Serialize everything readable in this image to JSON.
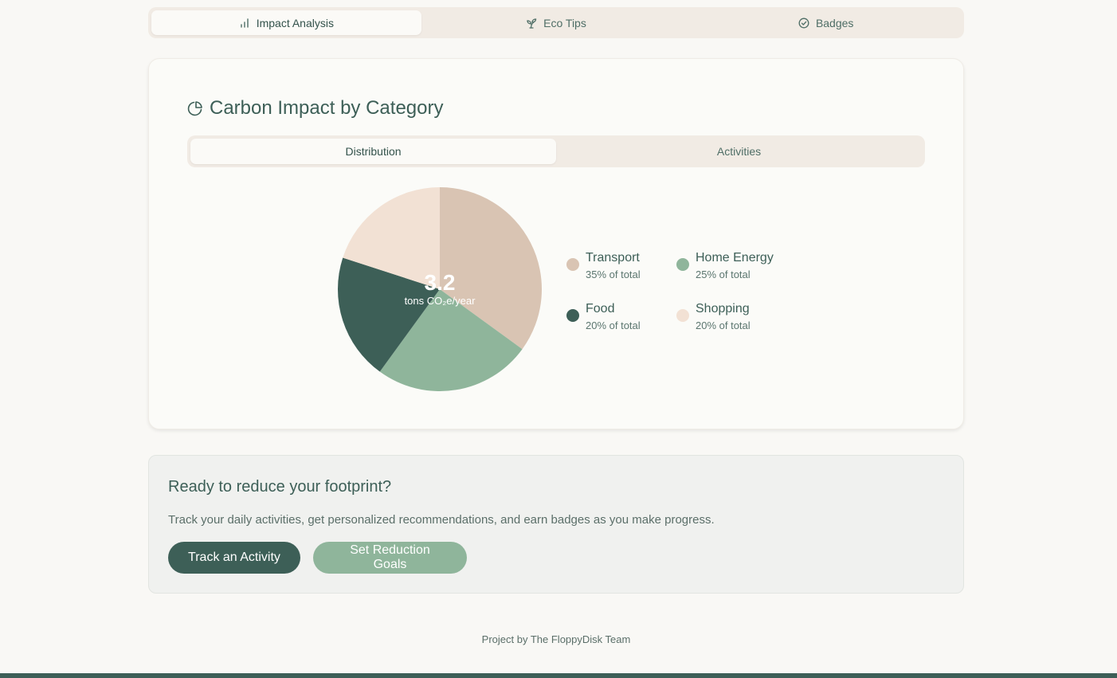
{
  "top_tabs": [
    {
      "label": "Impact Analysis",
      "icon": "bar-chart-icon",
      "active": true
    },
    {
      "label": "Eco Tips",
      "icon": "sprout-icon",
      "active": false
    },
    {
      "label": "Badges",
      "icon": "check-circle-icon",
      "active": false
    }
  ],
  "card": {
    "title": "Carbon Impact by Category",
    "title_icon": "pie-chart-icon",
    "sub_tabs": [
      {
        "label": "Distribution",
        "active": true
      },
      {
        "label": "Activities",
        "active": false
      }
    ],
    "center_value": "3.2",
    "center_unit": "tons CO₂e/year"
  },
  "chart_data": {
    "type": "pie",
    "title": "Carbon Impact by Category",
    "categories": [
      "Transport",
      "Home Energy",
      "Food",
      "Shopping"
    ],
    "values": [
      35,
      25,
      20,
      20
    ],
    "value_labels": [
      "35% of total",
      "25% of total",
      "20% of total",
      "20% of total"
    ],
    "colors": [
      "#d9c4b3",
      "#8fb59b",
      "#3d5f57",
      "#f2e1d4"
    ],
    "legend_position": "right"
  },
  "cta": {
    "title": "Ready to reduce your footprint?",
    "text": "Track your daily activities, get personalized recommendations, and earn badges as you make progress.",
    "primary_button": "Track an Activity",
    "secondary_button": "Set Reduction Goals"
  },
  "footer": {
    "text": "Project by The FloppyDisk Team"
  },
  "colors": {
    "accent": "#3d5f57",
    "secondary": "#8fb59b",
    "background": "#f9f8f5"
  }
}
